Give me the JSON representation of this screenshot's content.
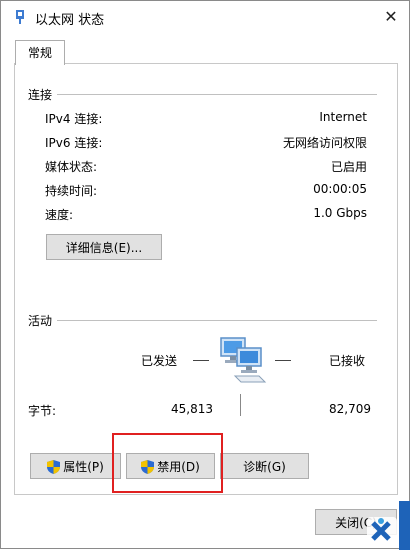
{
  "window": {
    "title": "以太网 状态",
    "close_glyph": "✕"
  },
  "tabs": [
    {
      "label": "常规",
      "selected": true
    }
  ],
  "connection": {
    "group_label": "连接",
    "rows": [
      {
        "label": "IPv4 连接:",
        "value": "Internet"
      },
      {
        "label": "IPv6 连接:",
        "value": "无网络访问权限"
      },
      {
        "label": "媒体状态:",
        "value": "已启用"
      },
      {
        "label": "持续时间:",
        "value": "00:00:05"
      },
      {
        "label": "速度:",
        "value": "1.0 Gbps"
      }
    ],
    "details_button": "详细信息(E)..."
  },
  "activity": {
    "group_label": "活动",
    "sent_label": "已发送",
    "received_label": "已接收",
    "bytes_label": "字节:",
    "bytes_sent": "45,813",
    "bytes_received": "82,709",
    "icon": "network-computers-icon"
  },
  "buttons": {
    "properties": "属性(P)",
    "disable": "禁用(D)",
    "diagnose": "诊断(G)",
    "close": "关闭(C)"
  },
  "colors": {
    "highlight_box": "#e02020",
    "button_face": "#e1e1e1",
    "shield_blue": "#2c6bd1",
    "shield_yellow": "#f2c300"
  }
}
